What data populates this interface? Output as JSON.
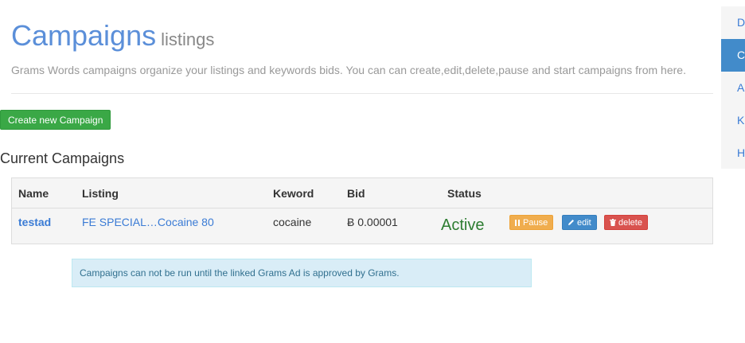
{
  "header": {
    "title": "Campaigns",
    "subtitle": "listings",
    "description": "Grams Words campaigns organize your listings and keywords bids. You can can create,edit,delete,pause and start campaigns from here."
  },
  "create_button_label": "Create new Campaign",
  "section_title": "Current Campaigns",
  "table": {
    "headers": [
      "Name",
      "Listing",
      "Keword",
      "Bid",
      "Status"
    ],
    "rows": [
      {
        "name": "testad",
        "listing": "FE SPECIAL…Cocaine 80",
        "keyword": "cocaine",
        "bid": "Ƀ 0.00001",
        "status": "Active",
        "actions": {
          "pause": "Pause",
          "edit": "edit",
          "delete": "delete"
        }
      }
    ]
  },
  "alert": "Campaigns can not be run until the linked Grams Ad is approved by Grams.",
  "sidebar": {
    "items": [
      "D",
      "C",
      "A",
      "K",
      "H"
    ],
    "active_index": 1
  },
  "colors": {
    "title": "#5b8fd9",
    "create_button": "#3aa846",
    "status_active": "#2e7d32",
    "pause": "#f0ad4e",
    "edit": "#428bca",
    "delete": "#d9534f",
    "alert_bg": "#d9edf7"
  }
}
